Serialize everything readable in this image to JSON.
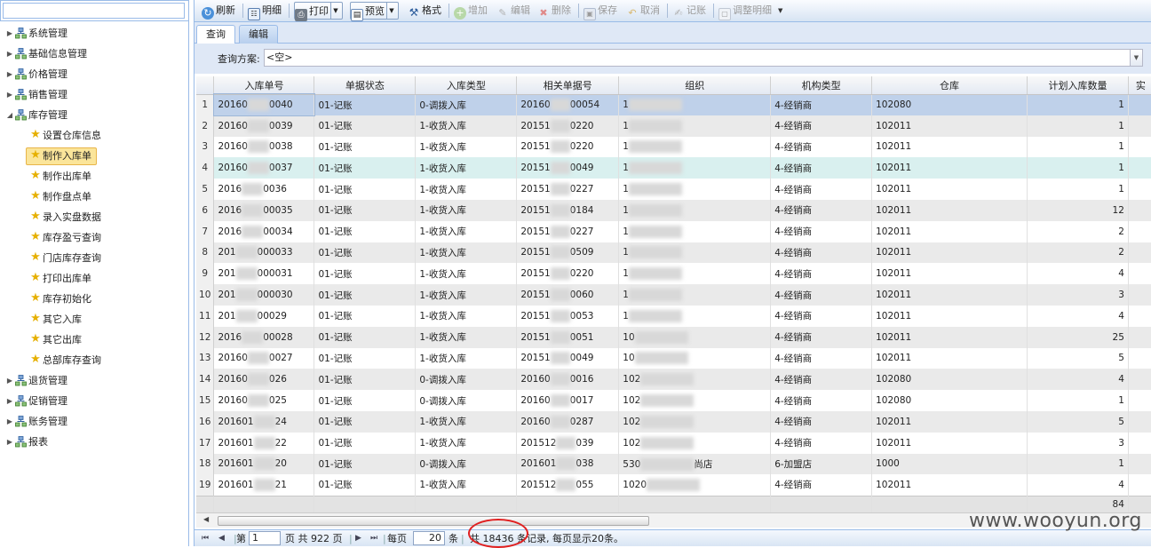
{
  "sidebar": {
    "search_value": "",
    "tree": [
      {
        "label": "系统管理",
        "level": 0,
        "expanded": false
      },
      {
        "label": "基础信息管理",
        "level": 0,
        "expanded": false
      },
      {
        "label": "价格管理",
        "level": 0,
        "expanded": false
      },
      {
        "label": "销售管理",
        "level": 0,
        "expanded": false
      },
      {
        "label": "库存管理",
        "level": 0,
        "expanded": true
      },
      {
        "label": "设置仓库信息",
        "level": 1
      },
      {
        "label": "制作入库单",
        "level": 1,
        "selected": true
      },
      {
        "label": "制作出库单",
        "level": 1
      },
      {
        "label": "制作盘点单",
        "level": 1
      },
      {
        "label": "录入实盘数据",
        "level": 1
      },
      {
        "label": "库存盈亏查询",
        "level": 1
      },
      {
        "label": "门店库存查询",
        "level": 1
      },
      {
        "label": "打印出库单",
        "level": 1
      },
      {
        "label": "库存初始化",
        "level": 1
      },
      {
        "label": "其它入库",
        "level": 1
      },
      {
        "label": "其它出库",
        "level": 1
      },
      {
        "label": "总部库存查询",
        "level": 1
      },
      {
        "label": "退货管理",
        "level": 0,
        "expanded": false
      },
      {
        "label": "促销管理",
        "level": 0,
        "expanded": false
      },
      {
        "label": "账务管理",
        "level": 0,
        "expanded": false
      },
      {
        "label": "报表",
        "level": 0,
        "expanded": false
      }
    ]
  },
  "toolbar": {
    "refresh": "刷新",
    "detail": "明细",
    "print": "打印",
    "preview": "预览",
    "format": "格式",
    "add": "增加",
    "edit": "编辑",
    "delete": "删除",
    "save": "保存",
    "cancel": "取消",
    "post": "记账",
    "adjust_detail": "调整明细"
  },
  "tabs": {
    "query": "查询",
    "edit": "编辑"
  },
  "query": {
    "label": "查询方案:",
    "value": "<空>"
  },
  "grid": {
    "columns": [
      "入库单号",
      "单据状态",
      "入库类型",
      "相关单据号",
      "组织",
      "机构类型",
      "仓库",
      "计划入库数量",
      "实"
    ],
    "rows": [
      {
        "n": "1",
        "order_prefix": "20160",
        "order_suffix": "0040",
        "status": "01-记账",
        "type": "0-调拨入库",
        "ref_prefix": "20160",
        "ref_suffix": "00054",
        "org_prefix": "1",
        "org_suffix": "",
        "inst": "4-经销商",
        "wh": "102080",
        "qty": "1"
      },
      {
        "n": "2",
        "order_prefix": "20160",
        "order_suffix": "0039",
        "status": "01-记账",
        "type": "1-收货入库",
        "ref_prefix": "20151",
        "ref_suffix": "0220",
        "org_prefix": "1",
        "org_suffix": "",
        "inst": "4-经销商",
        "wh": "102011",
        "qty": "1"
      },
      {
        "n": "3",
        "order_prefix": "20160",
        "order_suffix": "0038",
        "status": "01-记账",
        "type": "1-收货入库",
        "ref_prefix": "20151",
        "ref_suffix": "0220",
        "org_prefix": "1",
        "org_suffix": "",
        "inst": "4-经销商",
        "wh": "102011",
        "qty": "1"
      },
      {
        "n": "4",
        "order_prefix": "20160",
        "order_suffix": "0037",
        "status": "01-记账",
        "type": "1-收货入库",
        "ref_prefix": "20151",
        "ref_suffix": "0049",
        "org_prefix": "1",
        "org_suffix": "",
        "inst": "4-经销商",
        "wh": "102011",
        "qty": "1"
      },
      {
        "n": "5",
        "order_prefix": "2016",
        "order_suffix": "0036",
        "status": "01-记账",
        "type": "1-收货入库",
        "ref_prefix": "20151",
        "ref_suffix": "0227",
        "org_prefix": "1",
        "org_suffix": "",
        "inst": "4-经销商",
        "wh": "102011",
        "qty": "1"
      },
      {
        "n": "6",
        "order_prefix": "2016",
        "order_suffix": "00035",
        "status": "01-记账",
        "type": "1-收货入库",
        "ref_prefix": "20151",
        "ref_suffix": "0184",
        "org_prefix": "1",
        "org_suffix": "",
        "inst": "4-经销商",
        "wh": "102011",
        "qty": "12"
      },
      {
        "n": "7",
        "order_prefix": "2016",
        "order_suffix": "00034",
        "status": "01-记账",
        "type": "1-收货入库",
        "ref_prefix": "20151",
        "ref_suffix": "0227",
        "org_prefix": "1",
        "org_suffix": "",
        "inst": "4-经销商",
        "wh": "102011",
        "qty": "2"
      },
      {
        "n": "8",
        "order_prefix": "201",
        "order_suffix": "000033",
        "status": "01-记账",
        "type": "1-收货入库",
        "ref_prefix": "20151",
        "ref_suffix": "0509",
        "org_prefix": "1",
        "org_suffix": "",
        "inst": "4-经销商",
        "wh": "102011",
        "qty": "2"
      },
      {
        "n": "9",
        "order_prefix": "201",
        "order_suffix": "000031",
        "status": "01-记账",
        "type": "1-收货入库",
        "ref_prefix": "20151",
        "ref_suffix": "0220",
        "org_prefix": "1",
        "org_suffix": "",
        "inst": "4-经销商",
        "wh": "102011",
        "qty": "4"
      },
      {
        "n": "10",
        "order_prefix": "201",
        "order_suffix": "000030",
        "status": "01-记账",
        "type": "1-收货入库",
        "ref_prefix": "20151",
        "ref_suffix": "0060",
        "org_prefix": "1",
        "org_suffix": "",
        "inst": "4-经销商",
        "wh": "102011",
        "qty": "3"
      },
      {
        "n": "11",
        "order_prefix": "201",
        "order_suffix": "00029",
        "status": "01-记账",
        "type": "1-收货入库",
        "ref_prefix": "20151",
        "ref_suffix": "0053",
        "org_prefix": "1",
        "org_suffix": "",
        "inst": "4-经销商",
        "wh": "102011",
        "qty": "4"
      },
      {
        "n": "12",
        "order_prefix": "2016",
        "order_suffix": "00028",
        "status": "01-记账",
        "type": "1-收货入库",
        "ref_prefix": "20151",
        "ref_suffix": "0051",
        "org_prefix": "10",
        "org_suffix": "",
        "inst": "4-经销商",
        "wh": "102011",
        "qty": "25"
      },
      {
        "n": "13",
        "order_prefix": "20160",
        "order_suffix": "0027",
        "status": "01-记账",
        "type": "1-收货入库",
        "ref_prefix": "20151",
        "ref_suffix": "0049",
        "org_prefix": "10",
        "org_suffix": "",
        "inst": "4-经销商",
        "wh": "102011",
        "qty": "5"
      },
      {
        "n": "14",
        "order_prefix": "20160",
        "order_suffix": "026",
        "status": "01-记账",
        "type": "0-调拨入库",
        "ref_prefix": "20160",
        "ref_suffix": "0016",
        "org_prefix": "102",
        "org_suffix": "",
        "inst": "4-经销商",
        "wh": "102080",
        "qty": "4"
      },
      {
        "n": "15",
        "order_prefix": "20160",
        "order_suffix": "025",
        "status": "01-记账",
        "type": "0-调拨入库",
        "ref_prefix": "20160",
        "ref_suffix": "0017",
        "org_prefix": "102",
        "org_suffix": "",
        "inst": "4-经销商",
        "wh": "102080",
        "qty": "1"
      },
      {
        "n": "16",
        "order_prefix": "201601",
        "order_suffix": "24",
        "status": "01-记账",
        "type": "1-收货入库",
        "ref_prefix": "20160",
        "ref_suffix": "0287",
        "org_prefix": "102",
        "org_suffix": "",
        "inst": "4-经销商",
        "wh": "102011",
        "qty": "5"
      },
      {
        "n": "17",
        "order_prefix": "201601",
        "order_suffix": "22",
        "status": "01-记账",
        "type": "1-收货入库",
        "ref_prefix": "201512",
        "ref_suffix": "039",
        "org_prefix": "102",
        "org_suffix": "",
        "inst": "4-经销商",
        "wh": "102011",
        "qty": "3"
      },
      {
        "n": "18",
        "order_prefix": "201601",
        "order_suffix": "20",
        "status": "01-记账",
        "type": "0-调拨入库",
        "ref_prefix": "201601",
        "ref_suffix": "038",
        "org_prefix": "530",
        "org_suffix": "尚店",
        "inst": "6-加盟店",
        "wh": "1000",
        "qty": "1"
      },
      {
        "n": "19",
        "order_prefix": "201601",
        "order_suffix": "21",
        "status": "01-记账",
        "type": "1-收货入库",
        "ref_prefix": "201512",
        "ref_suffix": "055",
        "org_prefix": "1020",
        "org_suffix": "",
        "inst": "4-经销商",
        "wh": "102011",
        "qty": "4"
      }
    ],
    "sum_qty": "84"
  },
  "pager": {
    "page_prefix": "第",
    "page_value": "1",
    "page_suffix": "页 共 922 页",
    "per_page_label": "每页",
    "per_page_value": "20",
    "per_page_unit": "条",
    "summary": "共 18436 条记录, 每页显示20条。"
  },
  "watermark": "www.wooyun.org",
  "colors": {
    "accent": "#99bbe8",
    "selected_tree": "#fbe59a",
    "row_selected": "#bfd1ea",
    "row_highlight": "#d9f0ef",
    "circle": "#e02020"
  }
}
